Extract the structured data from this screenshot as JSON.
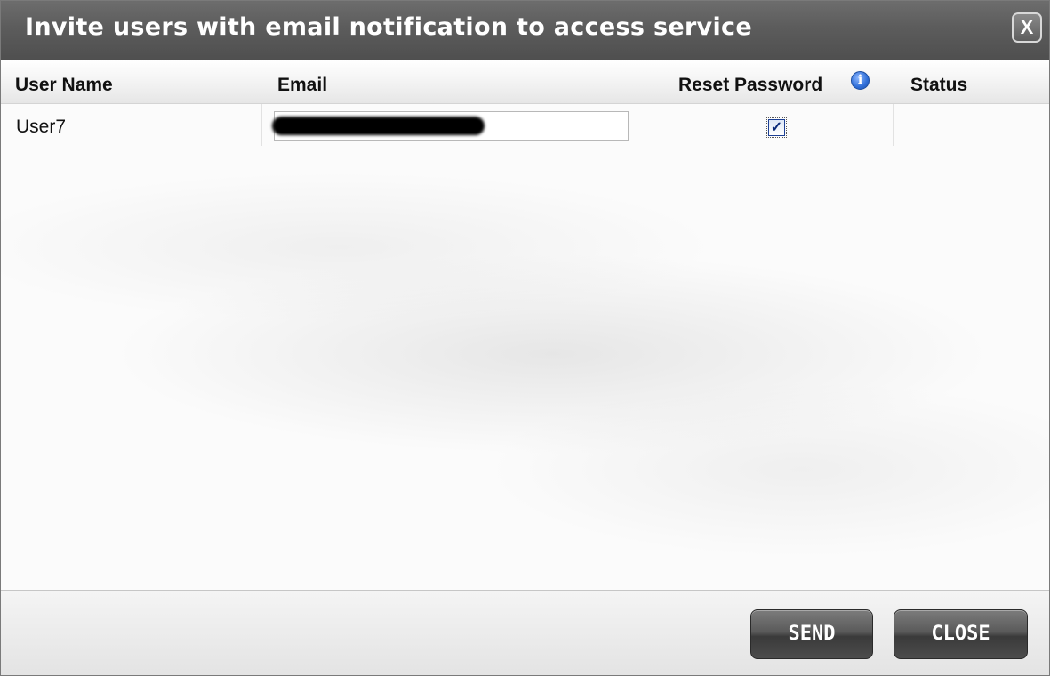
{
  "dialog": {
    "title": "Invite users with email notification to access service",
    "close_icon_glyph": "X"
  },
  "table": {
    "columns": [
      "User Name",
      "Email",
      "Reset Password",
      "Status"
    ],
    "info_icon_glyph": "i",
    "rows": [
      {
        "user_name": "User7",
        "email": "",
        "reset_password": true,
        "status": ""
      }
    ]
  },
  "checkbox_glyph": "✓",
  "buttons": {
    "send": "SEND",
    "close": "CLOSE"
  },
  "colors": {
    "titlebar": "#5c5c5c",
    "button": "#4c4c4c",
    "info_icon": "#2f6ed8"
  }
}
